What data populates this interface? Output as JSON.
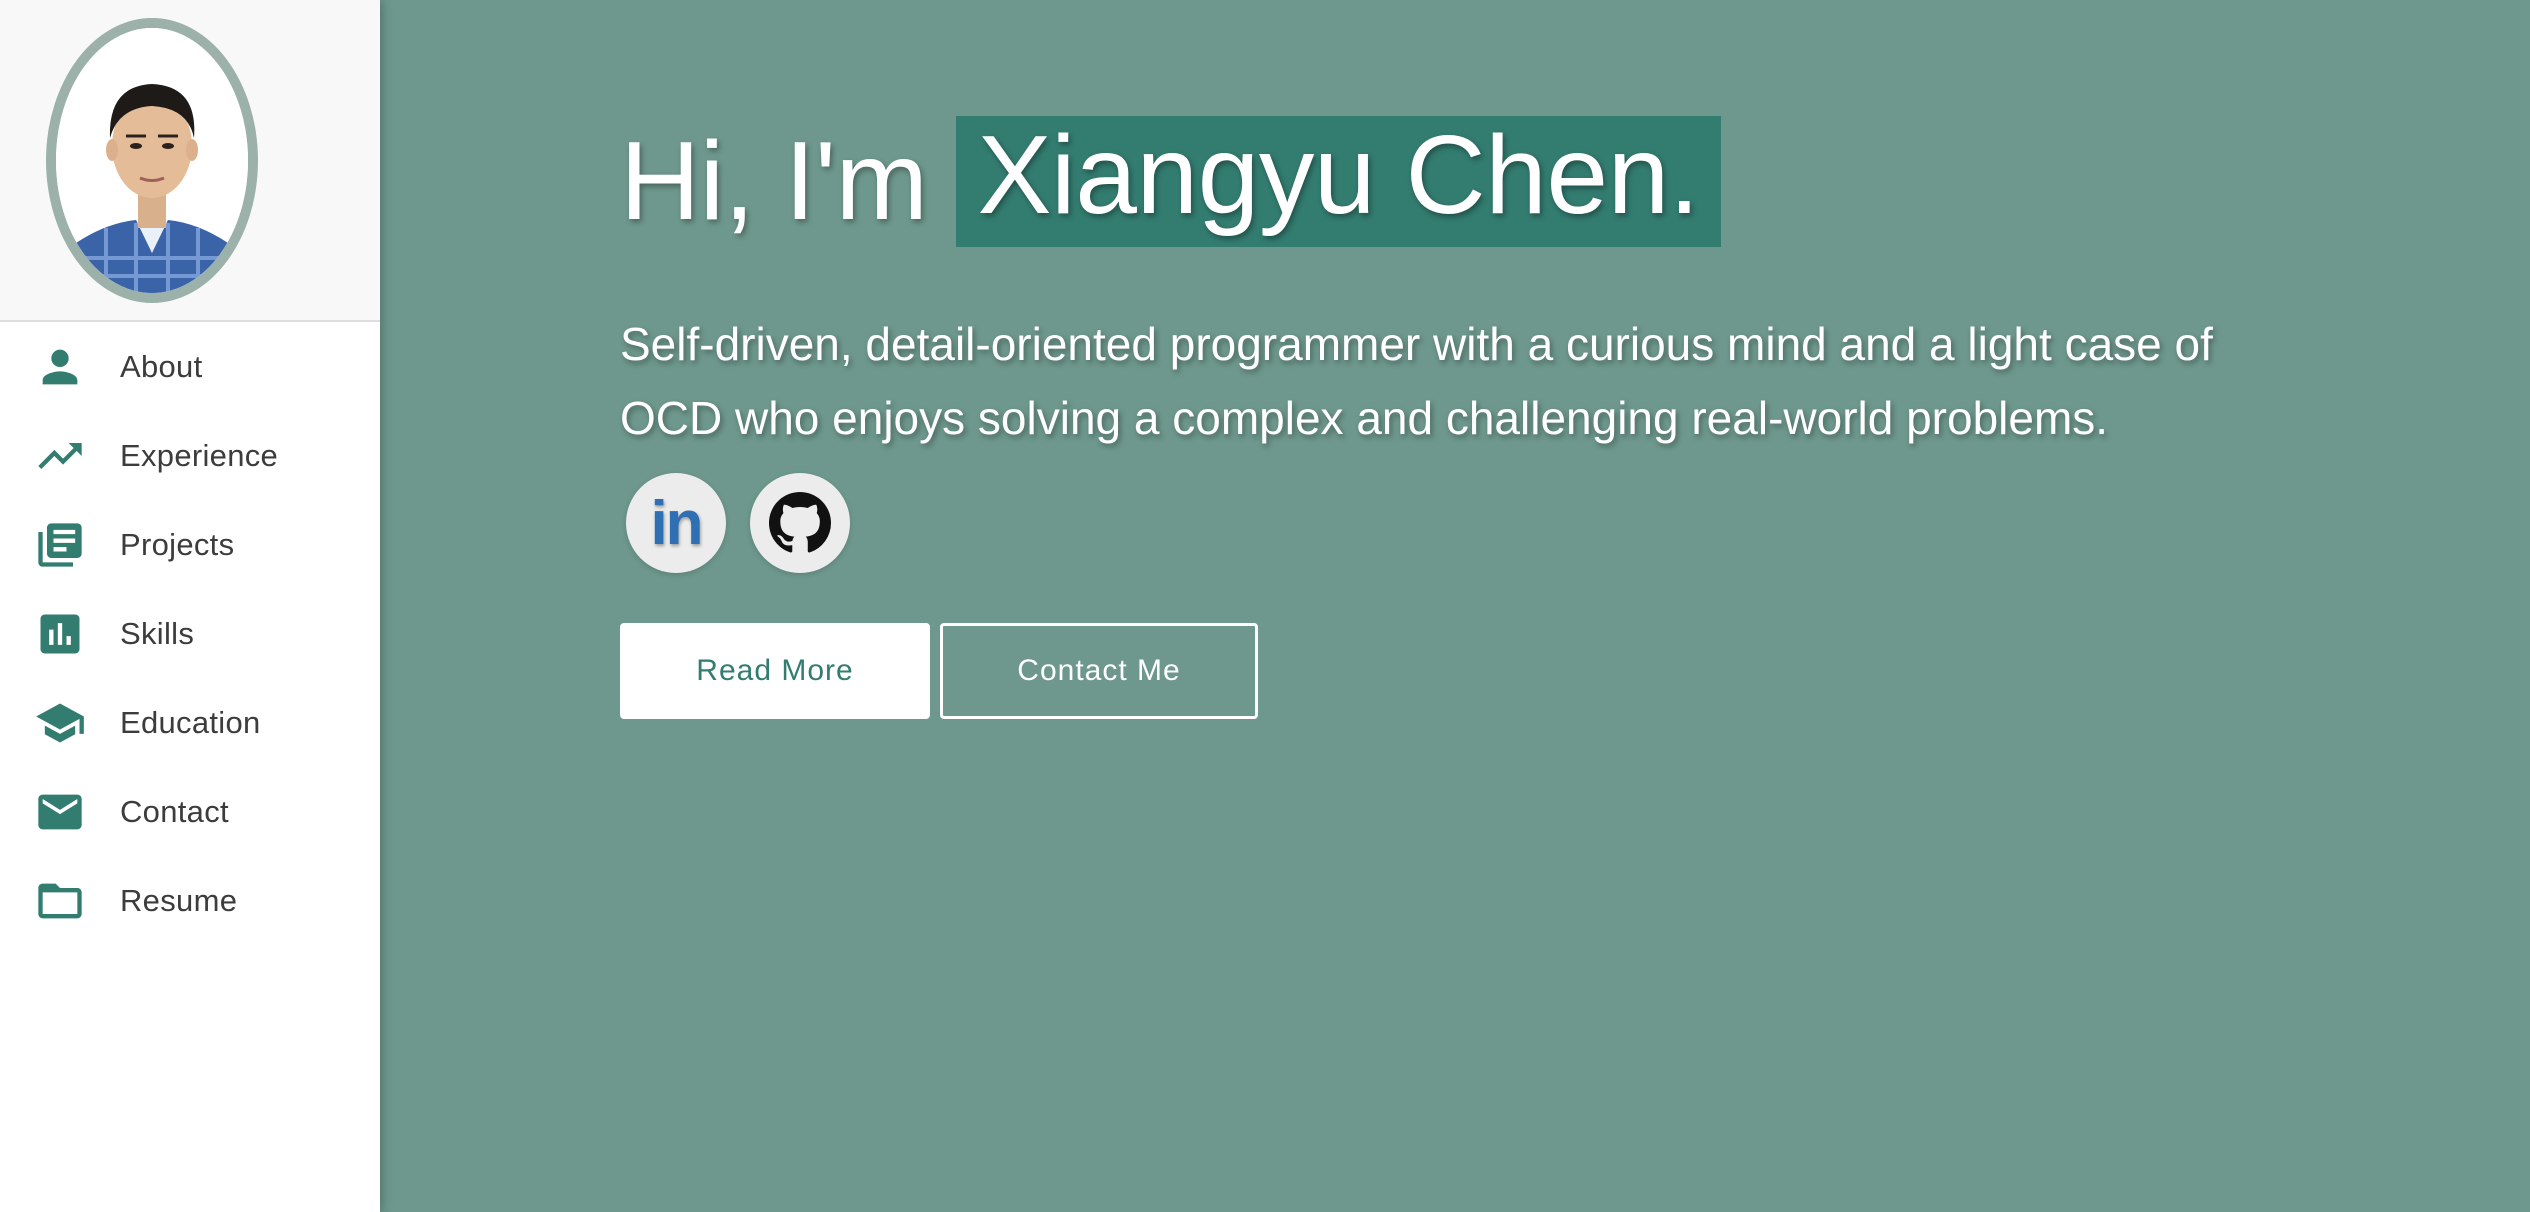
{
  "sidebar": {
    "avatar_alt": "profile photo",
    "items": [
      {
        "label": "About",
        "icon": "person-icon"
      },
      {
        "label": "Experience",
        "icon": "trending-up-icon"
      },
      {
        "label": "Projects",
        "icon": "library-books-icon"
      },
      {
        "label": "Skills",
        "icon": "bar-chart-icon"
      },
      {
        "label": "Education",
        "icon": "school-icon"
      },
      {
        "label": "Contact",
        "icon": "mail-icon"
      },
      {
        "label": "Resume",
        "icon": "folder-icon"
      }
    ]
  },
  "hero": {
    "greeting": "Hi, I'm",
    "name": "Xiangyu Chen.",
    "tagline": "Self-driven, detail-oriented programmer with a curious mind and a light case of OCD who enjoys solving a complex and challenging real-world problems.",
    "socials": [
      {
        "label": "in",
        "icon": "linkedin-icon"
      },
      {
        "label": "",
        "icon": "github-icon"
      }
    ],
    "read_more": "Read More",
    "contact_me": "Contact Me"
  },
  "colors": {
    "accent": "#337c70",
    "hero_bg": "#6e988d",
    "avatar_border": "#9cb1aa",
    "linkedin": "#2f6fb3"
  }
}
